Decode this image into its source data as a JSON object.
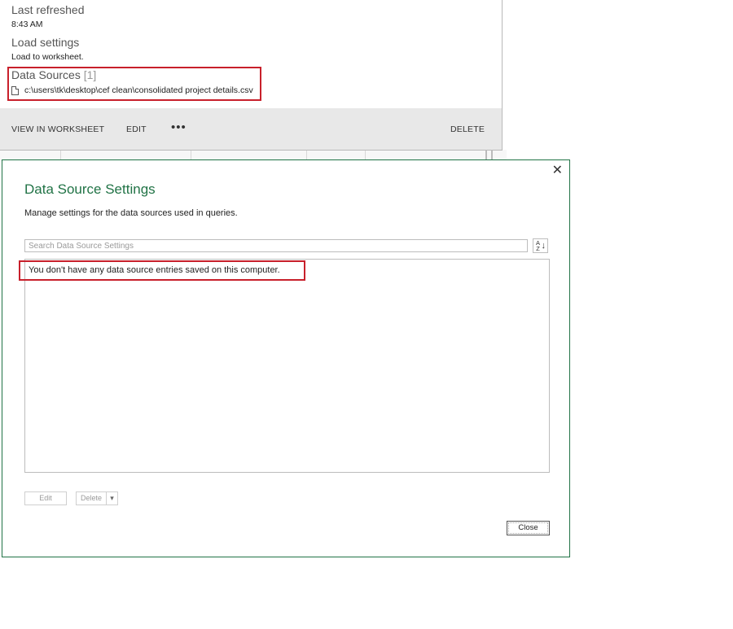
{
  "query_panel": {
    "last_refreshed_label": "Last refreshed",
    "last_refreshed_value": "8:43 AM",
    "load_settings_label": "Load settings",
    "load_settings_value": "Load to worksheet.",
    "data_sources_label": "Data Sources",
    "data_sources_count": "[1]",
    "data_source_file": "c:\\users\\tk\\desktop\\cef clean\\consolidated project details.csv",
    "file_icon": "document-icon",
    "toolbar": {
      "view_in_worksheet": "VIEW IN WORKSHEET",
      "edit": "EDIT",
      "more": "•••",
      "delete": "DELETE"
    }
  },
  "dialog": {
    "title": "Data Source Settings",
    "subtitle": "Manage settings for the data sources used in queries.",
    "close_x": "✕",
    "search_placeholder": "Search Data Source Settings",
    "sort_icon": "sort-az-icon",
    "empty_message": "You don't have any data source entries saved on this computer.",
    "buttons": {
      "edit": "Edit",
      "delete": "Delete",
      "delete_dropdown": "▾",
      "close": "Close"
    }
  },
  "colors": {
    "accent_green": "#217346",
    "highlight_red": "#c8202b",
    "toolbar_gray": "#e8e8e8"
  }
}
